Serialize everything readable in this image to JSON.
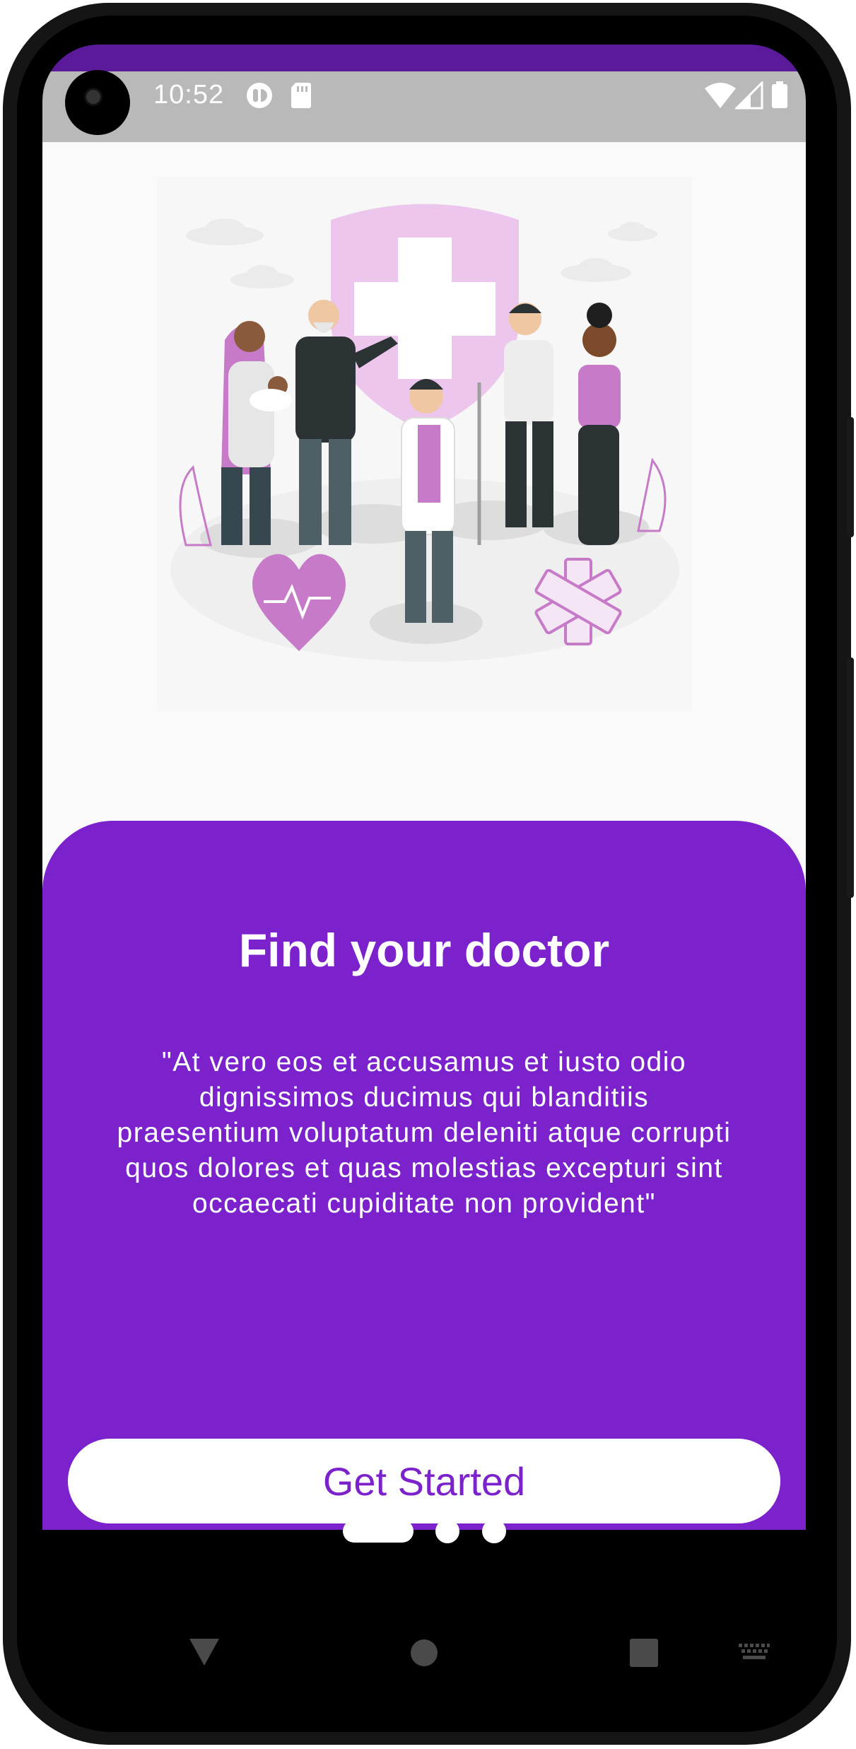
{
  "status_bar": {
    "time": "10:52",
    "icons": [
      "media-icon",
      "sd-card-icon",
      "wifi-icon",
      "signal-icon",
      "battery-icon"
    ]
  },
  "onboarding": {
    "illustration": "medical-team-illustration",
    "title": "Find your doctor",
    "description": "\"At vero eos et accusamus et iusto odio dignissimos ducimus qui blanditiis praesentium voluptatum deleniti atque corrupti quos dolores et quas molestias excepturi sint occaecati cupiditate non provident\"",
    "cta_label": "Get Started",
    "page_indicator": {
      "current": 1,
      "total": 3
    }
  },
  "navigation_bar": {
    "buttons": [
      "back-icon",
      "home-icon",
      "recents-icon",
      "keyboard-icon"
    ]
  },
  "colors": {
    "primary": "#7b22cc",
    "status_bar": "#b9b9b9",
    "background": "#fafafa",
    "white": "#ffffff"
  }
}
